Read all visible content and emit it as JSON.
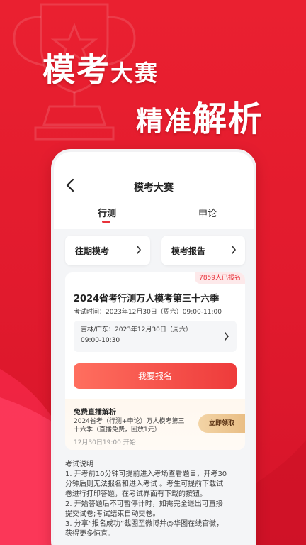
{
  "promo": {
    "line1_big": "模考",
    "line1_small": "大赛",
    "line2_small": "精准",
    "line2_big": "解析"
  },
  "header": {
    "title": "模考大赛",
    "tabs": [
      {
        "label": "行测",
        "active": true
      },
      {
        "label": "申论",
        "active": false
      }
    ]
  },
  "quick_links": [
    {
      "label": "往期模考"
    },
    {
      "label": "模考报告"
    }
  ],
  "exam_card": {
    "signup_badge": "7859人已报名",
    "title": "2024省考行测万人模考第三十六季",
    "exam_time": "考试时间：2023年12月30日（周六）09:00-11:00",
    "region_line1": "吉林/广东：2023年12月30日（周六）",
    "region_line2": "09:00-10:30",
    "signup_button": "我要报名"
  },
  "live": {
    "title": "免费直播解析",
    "desc_line1": "2024省考（行测+申论）万人模考第三",
    "desc_line2": "十六季（直播免费，回放1元）",
    "time": "12月30日19:00 开始",
    "claim_button": "立即领取"
  },
  "notes": {
    "heading": "考试说明",
    "lines": [
      "1. 开考前10分钟可提前进入考场查看题目，开考30",
      "分钟后则无法报名和进入考试 。考生可提前下载试",
      "卷进行打印答题，在考试界面有下载的按钮。",
      "2. 开始答题后不可暂停计时，如需完全退出可直接",
      "提交试卷;考试结束自动交卷。",
      "3. 分享“报名成功”截图至微博并@华图在线官微，",
      "获得更多惊喜。"
    ]
  },
  "colors": {
    "brand_red": "#e8323a",
    "gold": "#e9be85"
  }
}
